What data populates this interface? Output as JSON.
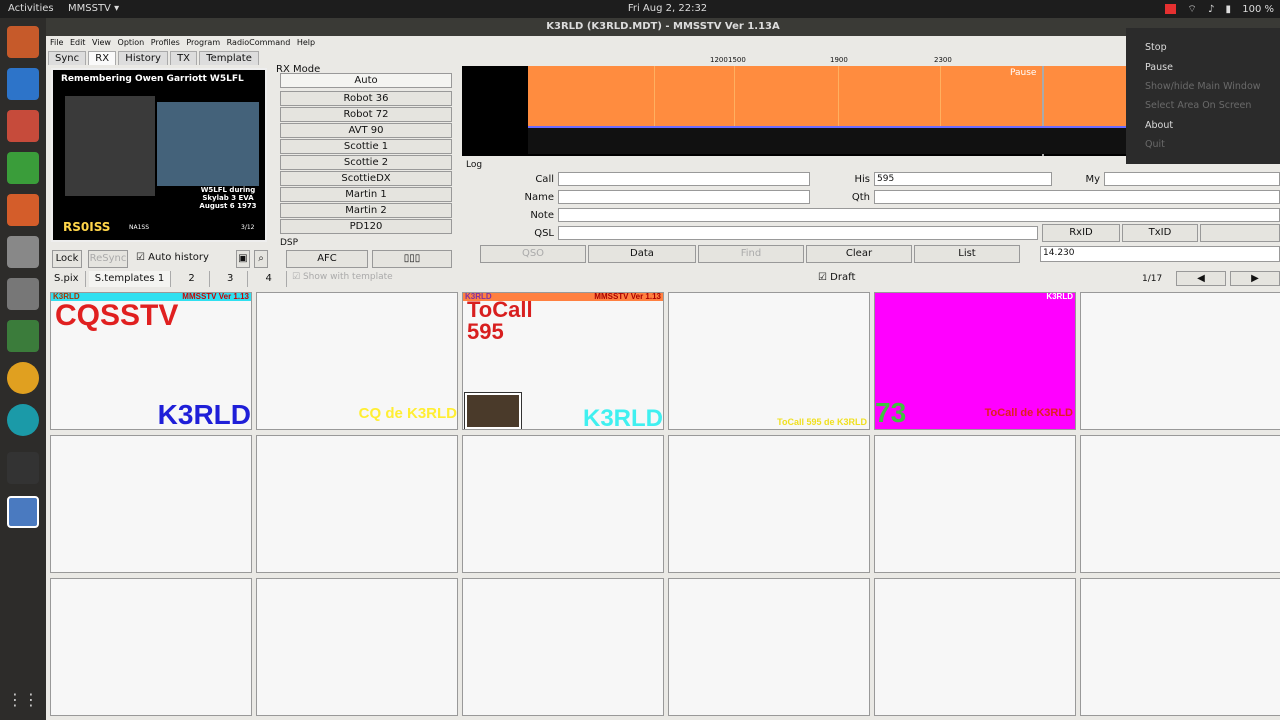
{
  "system": {
    "activities": "Activities",
    "app_menu": "MMSSTV ▾",
    "clock": "Fri Aug  2, 22:32",
    "battery": "100 %",
    "window_title": "K3RLD (K3RLD.MDT) - MMSSTV Ver 1.13A",
    "tray_menu": [
      "Stop",
      "Pause",
      "Show/hide Main Window",
      "Select Area On Screen",
      "About",
      "Quit"
    ]
  },
  "menu": [
    "File",
    "Edit",
    "View",
    "Option",
    "Profiles",
    "Program",
    "RadioCommand",
    "Help"
  ],
  "tabs": [
    "Sync",
    "RX",
    "History",
    "TX",
    "Template"
  ],
  "rx_image": {
    "title": "Remembering Owen Garriott W5LFL",
    "caption": "W5LFL during Skylab 3 EVA August 6 1973",
    "callsign": "RS0ISS",
    "small": "NA1SS",
    "page": "3/12"
  },
  "controls": {
    "lock": "Lock",
    "resync": "ReSync",
    "auto_history": "Auto history",
    "afc": "AFC",
    "dsp_label": "DSP",
    "rx_mode_label": "RX Mode"
  },
  "rx_modes": [
    "Auto",
    "Robot 36",
    "Robot 72",
    "AVT 90",
    "Scottie 1",
    "Scottie 2",
    "ScottieDX",
    "Martin 1",
    "Martin 2",
    "PD120"
  ],
  "spectrum": {
    "freqs": [
      "1200",
      "1500",
      "1900",
      "2300"
    ],
    "pause": "Pause"
  },
  "log": {
    "label": "Log",
    "call_label": "Call",
    "name_label": "Name",
    "note_label": "Note",
    "qsl_label": "QSL",
    "his_label": "His",
    "his_value": "595",
    "qth_label": "Qth",
    "my_label": "My",
    "rxid": "RxID",
    "txid": "TxID",
    "qso": "QSO",
    "data": "Data",
    "find": "Find",
    "clear": "Clear",
    "list": "List",
    "freq_value": "14.230"
  },
  "bottom_tabs": [
    "S.pix",
    "S.templates 1",
    "2",
    "3",
    "4"
  ],
  "show_template": "Show with template",
  "draft": "Draft",
  "page_count": "1/17",
  "templates": [
    {
      "top_left": "K3RLD",
      "top_right": "MMSSTV Ver 1.13",
      "main": "CQSSTV",
      "bottom": "K3RLD",
      "bar_color": "#30e0f0"
    },
    {
      "text": "CQ de K3RLD"
    },
    {
      "top_left": "K3RLD",
      "top_right": "MMSSTV Ver 1.13",
      "main": "ToCall",
      "main2": "595",
      "bottom": "K3RLD",
      "bar_color": "#ff8040"
    },
    {
      "text": "ToCall 595 de K3RLD"
    },
    {
      "top_right": "K3RLD",
      "main": "73",
      "bottom": "ToCall de K3RLD",
      "bg": "#ff00ff"
    }
  ]
}
